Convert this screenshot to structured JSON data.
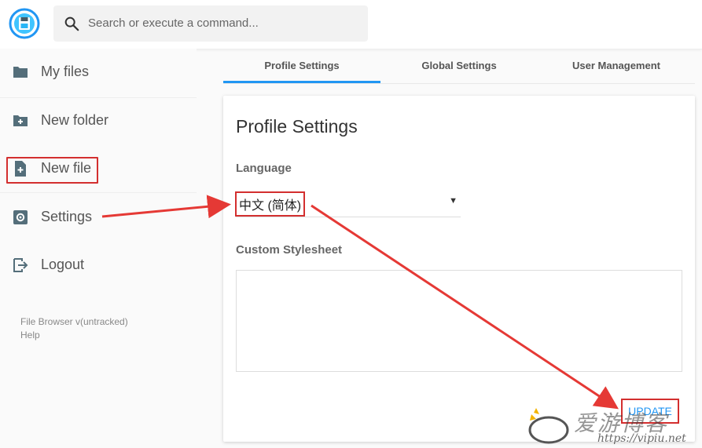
{
  "header": {
    "search_placeholder": "Search or execute a command..."
  },
  "sidebar": {
    "items": [
      {
        "label": "My files",
        "icon": "folder-icon"
      },
      {
        "label": "New folder",
        "icon": "new-folder-icon"
      },
      {
        "label": "New file",
        "icon": "new-file-icon"
      },
      {
        "label": "Settings",
        "icon": "gear-icon"
      },
      {
        "label": "Logout",
        "icon": "logout-icon"
      }
    ],
    "footer": {
      "version": "File Browser v(untracked)",
      "help": "Help"
    }
  },
  "tabs": [
    {
      "label": "Profile Settings",
      "active": true
    },
    {
      "label": "Global Settings",
      "active": false
    },
    {
      "label": "User Management",
      "active": false
    }
  ],
  "profile": {
    "title": "Profile Settings",
    "language_label": "Language",
    "language_value": "中文 (简体)",
    "stylesheet_label": "Custom Stylesheet",
    "stylesheet_value": "",
    "update_label": "UPDATE"
  },
  "watermark": {
    "text": "爱游博客",
    "url": "https://vipiu.net"
  },
  "colors": {
    "accent": "#2196f3",
    "annotation": "#d32f2f"
  }
}
